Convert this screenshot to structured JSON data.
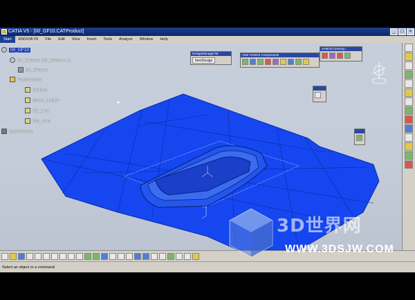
{
  "window": {
    "title": "CATIA V5 - [00_GF10.CATProduct]"
  },
  "menu": [
    "Start",
    "ENOVIA V5",
    "File",
    "Edit",
    "View",
    "Insert",
    "Tools",
    "Analyze",
    "Window",
    "Help"
  ],
  "tree": {
    "root": "00_GF10",
    "product": "00_Dieface (00_Dieface.1)",
    "part": "00_Dieface",
    "publications": "Publications",
    "items": [
      "Dieface",
      "Blank_Holder",
      "3D_Line",
      "Die_Axis"
    ],
    "applications": "Applications"
  },
  "toolbars": {
    "design_manager": {
      "title": "DesignManagerTB",
      "button": "ItemDesign"
    },
    "amd_vamos": {
      "title": "AMd VAMOS Components"
    },
    "vamos_develop": {
      "title": "VAMOS Develop..."
    }
  },
  "status": {
    "message": "Select an object or a command"
  },
  "watermark": {
    "brand": "3D世界网",
    "url": "WWW.3DSJW.COM"
  },
  "colors": {
    "surface": "#1546f0",
    "surface_edge": "#0a2aa8",
    "background": "#c7cedb"
  }
}
